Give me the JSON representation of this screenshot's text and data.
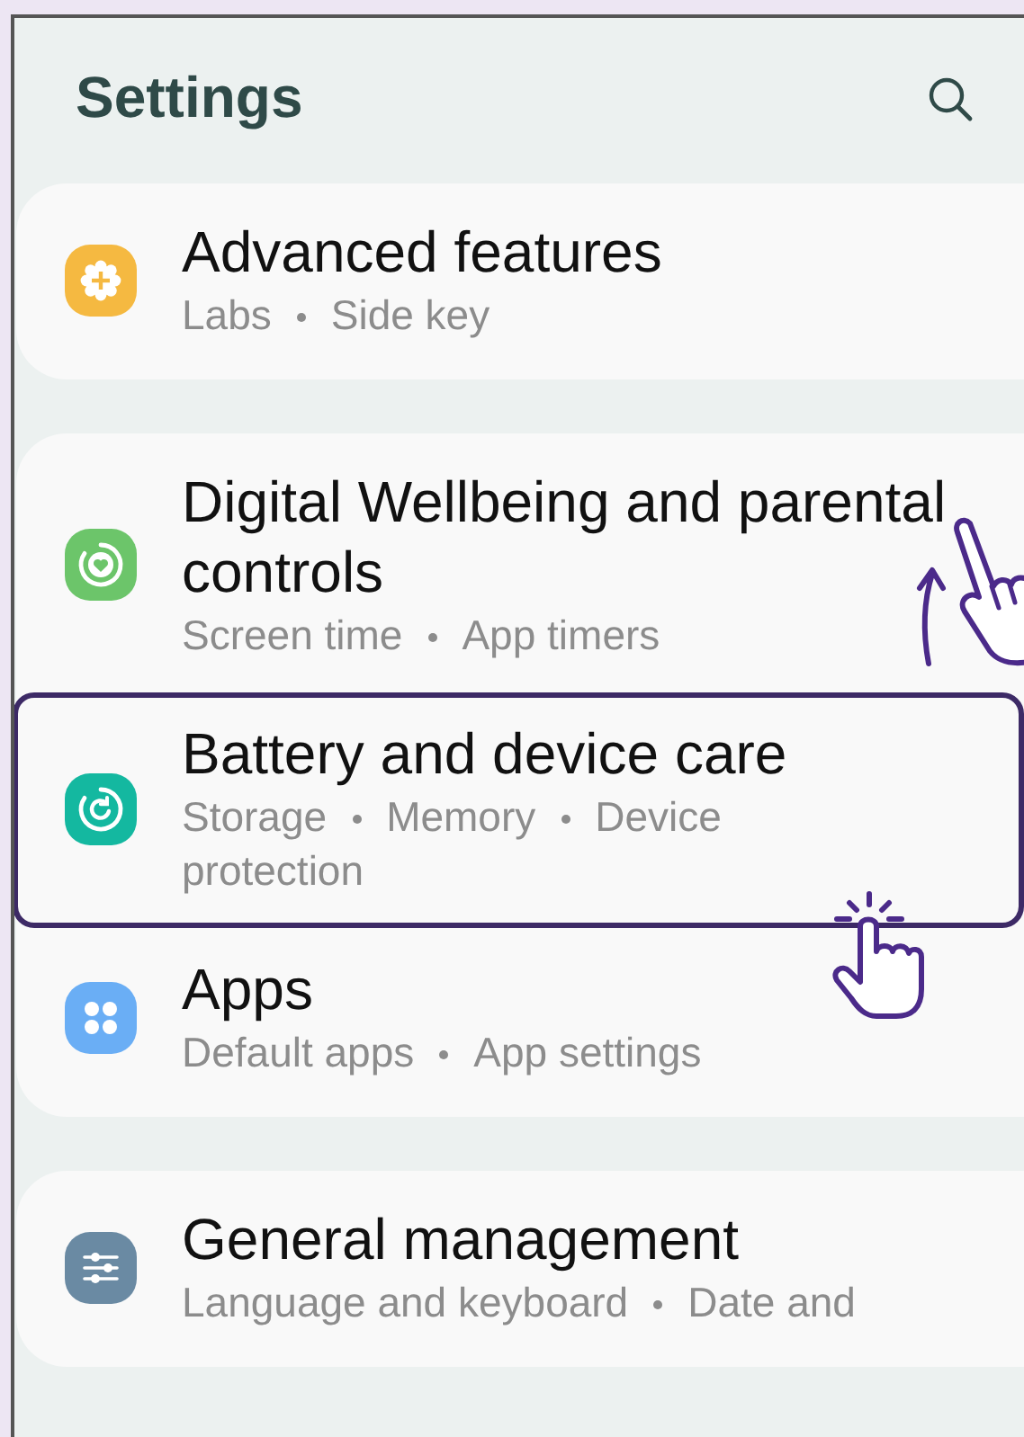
{
  "header": {
    "title": "Settings"
  },
  "groups": [
    {
      "items": [
        {
          "title": "Advanced features",
          "subtitle_parts": [
            "Labs",
            "Side key"
          ],
          "color": "#f5b941",
          "highlighted": false,
          "swipe_hint": false,
          "tap_hint": false
        }
      ]
    },
    {
      "items": [
        {
          "title": "Digital Wellbeing and parental controls",
          "subtitle_parts": [
            "Screen time",
            "App timers"
          ],
          "color": "#6cc56a",
          "highlighted": false,
          "swipe_hint": true,
          "tap_hint": false
        },
        {
          "title": "Battery and device care",
          "subtitle_parts": [
            "Storage",
            "Memory",
            "Device protection"
          ],
          "color": "#14b8a0",
          "highlighted": true,
          "swipe_hint": false,
          "tap_hint": true
        },
        {
          "title": "Apps",
          "subtitle_parts": [
            "Default apps",
            "App settings"
          ],
          "color": "#6aaef5",
          "highlighted": false,
          "swipe_hint": false,
          "tap_hint": false
        }
      ]
    },
    {
      "items": [
        {
          "title": "General management",
          "subtitle_parts": [
            "Language and keyboard",
            "Date and"
          ],
          "color": "#6a8aa3",
          "highlighted": false,
          "swipe_hint": false,
          "tap_hint": false
        }
      ]
    }
  ]
}
